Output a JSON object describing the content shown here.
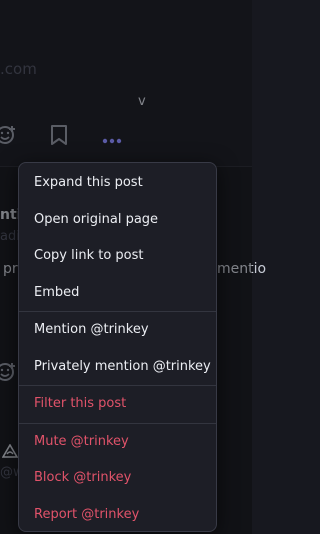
{
  "background": {
    "email_fragment": ".com",
    "chevron_text": "v",
    "name_fragment": "nti",
    "handle_fragment": "adic",
    "body_fragment_left": "pr",
    "body_fragment_right": "mentio",
    "handle_fragment_2": "@w"
  },
  "menu": {
    "items": [
      {
        "label": "Expand this post"
      },
      {
        "label": "Open original page"
      },
      {
        "label": "Copy link to post"
      },
      {
        "label": "Embed"
      },
      {
        "label": "Mention @trinkey"
      },
      {
        "label": "Privately mention @trinkey"
      },
      {
        "label": "Filter this post"
      },
      {
        "label": "Mute @trinkey"
      },
      {
        "label": "Block @trinkey"
      },
      {
        "label": "Report @trinkey"
      }
    ]
  },
  "colors": {
    "danger": "#e1536a",
    "accent": "#8c8dff"
  }
}
